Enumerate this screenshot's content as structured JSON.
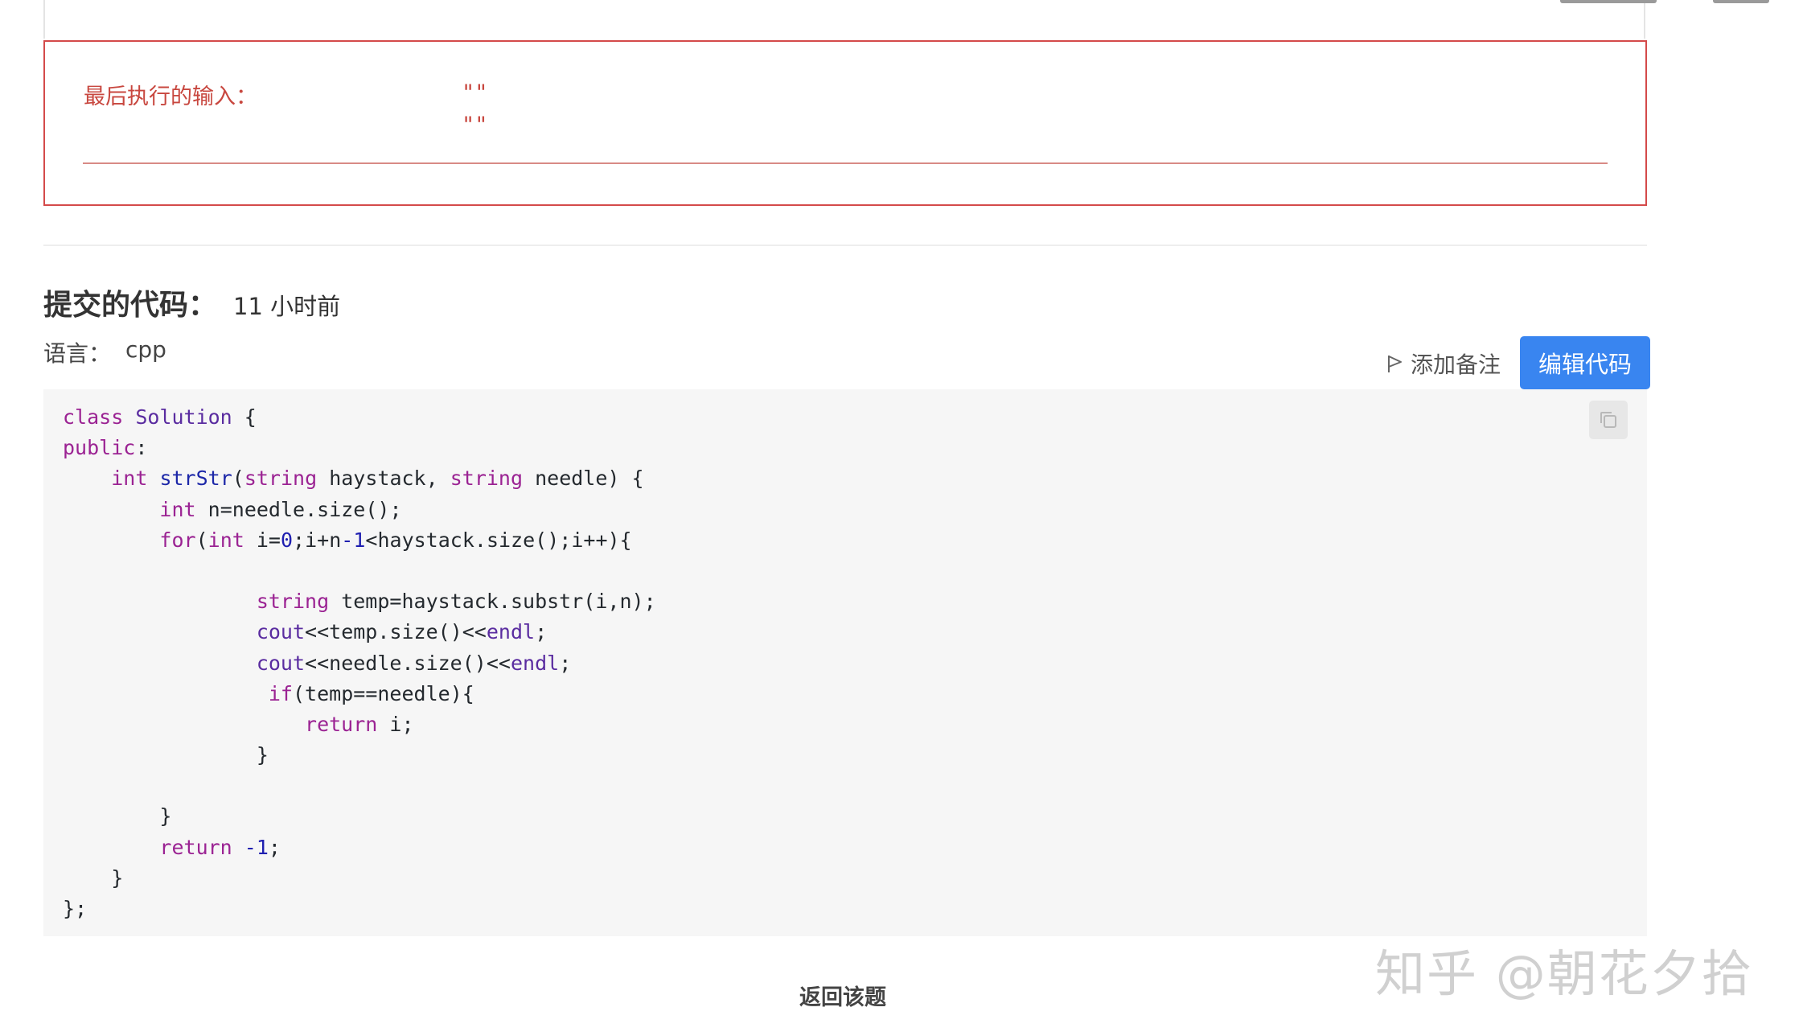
{
  "error": {
    "label": "最后执行的输入：",
    "values": [
      "\"\"",
      "\"\""
    ]
  },
  "submission": {
    "title": "提交的代码：",
    "time": "11 小时前",
    "language_label": "语言：",
    "language": "cpp"
  },
  "actions": {
    "note_icon": "flag-icon",
    "note_label": "添加备注",
    "edit_label": "编辑代码",
    "copy_icon": "copy-icon",
    "accent_color": "#3985f0"
  },
  "code": {
    "lines": [
      "class Solution {",
      "public:",
      "    int strStr(string haystack, string needle) {",
      "        int n=needle.size();",
      "        for(int i=0;i+n-1<haystack.size();i++){",
      "",
      "                string temp=haystack.substr(i,n);",
      "                cout<<temp.size()<<endl;",
      "                cout<<needle.size()<<endl;",
      "                 if(temp==needle){",
      "                    return i;",
      "                }",
      "",
      "        }",
      "        return -1;",
      "    }",
      "};"
    ]
  },
  "footer": {
    "back_label": "返回该题"
  },
  "watermark": {
    "text": "知乎 @朝花夕拾"
  }
}
